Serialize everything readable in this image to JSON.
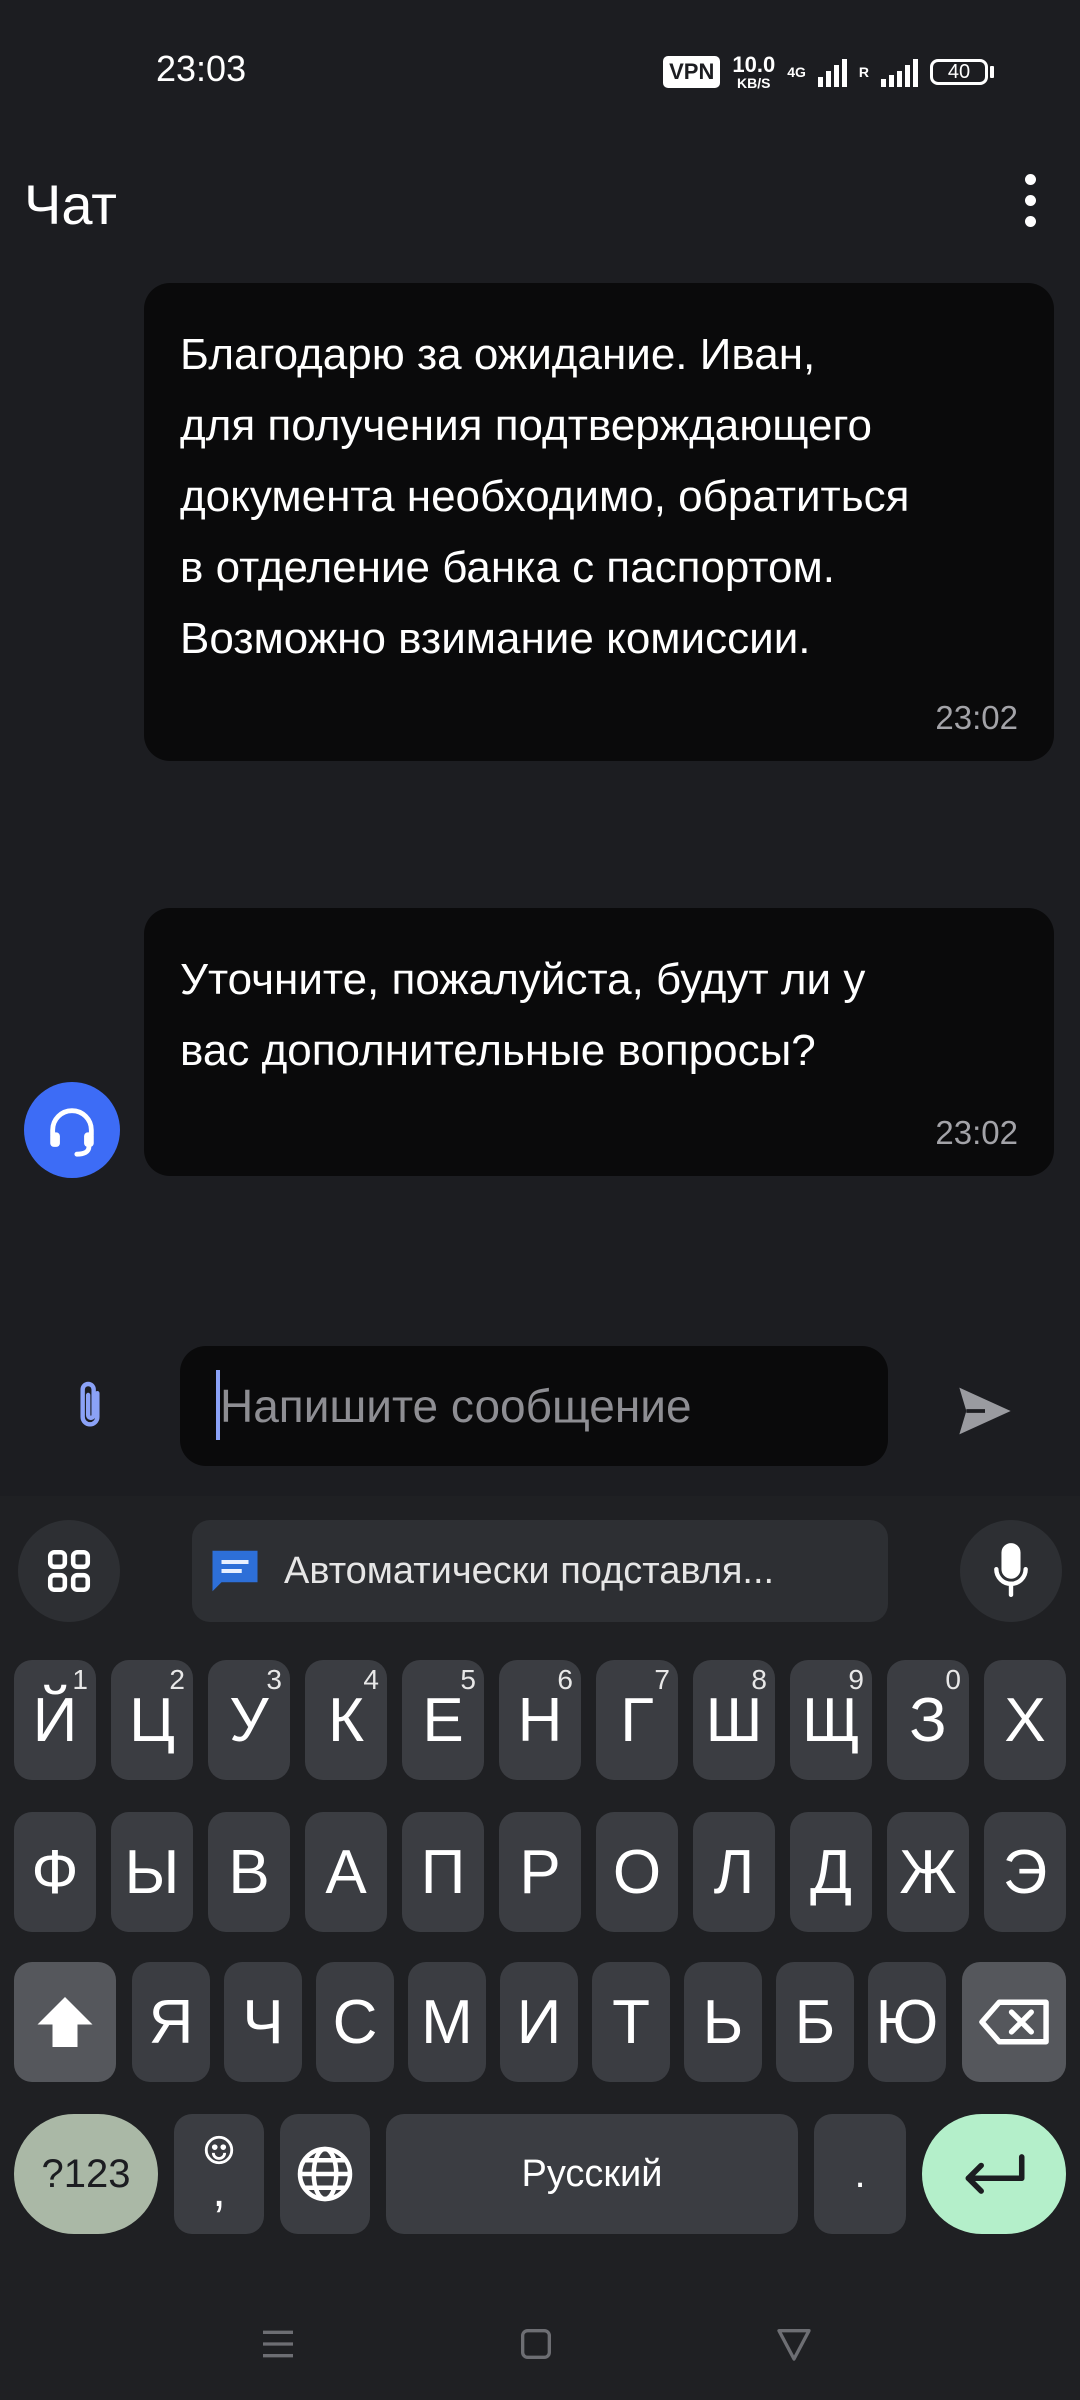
{
  "status_bar": {
    "time": "23:03",
    "vpn": "VPN",
    "speed_value": "10.0",
    "speed_unit": "KB/S",
    "network_type": "4G",
    "roaming": "R",
    "battery": "40"
  },
  "header": {
    "title": "Чат"
  },
  "messages": [
    {
      "text": "Благодарю за ожидание. Иван,\nдля получения подтверждающего\nдокумента необходимо, обратиться\nв отделение банка с паспортом.\nВозможно взимание комиссии.",
      "time": "23:02"
    },
    {
      "text": "Уточните, пожалуйста, будут ли у\nвас дополнительные вопросы?",
      "time": "23:02"
    }
  ],
  "composer": {
    "placeholder": "Напишите сообщение"
  },
  "keyboard": {
    "suggestion": "Автоматически подставля...",
    "row1": [
      {
        "k": "Й",
        "h": "1"
      },
      {
        "k": "Ц",
        "h": "2"
      },
      {
        "k": "У",
        "h": "3"
      },
      {
        "k": "К",
        "h": "4"
      },
      {
        "k": "Е",
        "h": "5"
      },
      {
        "k": "Н",
        "h": "6"
      },
      {
        "k": "Г",
        "h": "7"
      },
      {
        "k": "Ш",
        "h": "8"
      },
      {
        "k": "Щ",
        "h": "9"
      },
      {
        "k": "З",
        "h": "0"
      },
      {
        "k": "Х",
        "h": ""
      }
    ],
    "row2": [
      "Ф",
      "Ы",
      "В",
      "А",
      "П",
      "Р",
      "О",
      "Л",
      "Д",
      "Ж",
      "Э"
    ],
    "row3": [
      "Я",
      "Ч",
      "С",
      "М",
      "И",
      "Т",
      "Ь",
      "Б",
      "Ю"
    ],
    "num_label": "?123",
    "comma_label": ",",
    "space_label": "Русский",
    "period_label": "."
  },
  "colors": {
    "background": "#1c1d21",
    "bubble": "#0a0a0b",
    "accent": "#3d6cf6",
    "enter_key": "#b4efca"
  },
  "icons": {
    "menu": "more-vertical-icon",
    "avatar": "headset-icon",
    "attach": "paperclip-icon",
    "send": "send-icon",
    "grid": "apps-grid-icon",
    "suggestion": "chat-bubble-icon",
    "mic": "microphone-icon"
  }
}
